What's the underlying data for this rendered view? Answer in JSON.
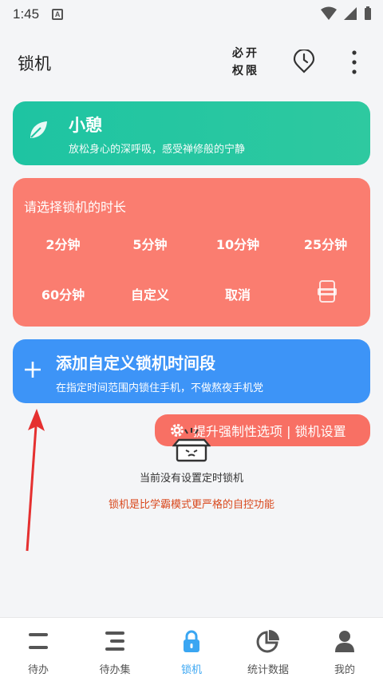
{
  "status": {
    "time": "1:45",
    "notif_letter": "A"
  },
  "appbar": {
    "title": "锁机",
    "perm_line1": "必开",
    "perm_line2": "权限",
    "clock_icon": "clock-icon",
    "more_icon": "more-vert-icon"
  },
  "rest_card": {
    "title": "小憩",
    "subtitle": "放松身心的深呼吸，感受禅修般的宁静",
    "icon": "leaf-icon",
    "color": "#1ec4a2"
  },
  "lock_card": {
    "heading": "请选择锁机的时长",
    "color": "#fa7d70",
    "options": [
      "2分钟",
      "5分钟",
      "10分钟",
      "25分钟",
      "60分钟",
      "自定义",
      "取消"
    ],
    "app_icon": "app-icon"
  },
  "add_card": {
    "title": "添加自定义锁机时间段",
    "subtitle": "在指定时间范围内锁住手机，不做熬夜手机党",
    "color": "#3d94f7"
  },
  "boost": {
    "label": "提升强制性选项 | 锁机设置",
    "icon": "gear-icon"
  },
  "empty": {
    "text": "当前没有设置定时锁机",
    "hint": "锁机是比学霸模式更严格的自控功能"
  },
  "tabs": [
    {
      "label": "待办",
      "icon": "todo-icon",
      "active": false
    },
    {
      "label": "待办集",
      "icon": "todo-list-icon",
      "active": false
    },
    {
      "label": "锁机",
      "icon": "lock-icon",
      "active": true
    },
    {
      "label": "统计数据",
      "icon": "pie-chart-icon",
      "active": false
    },
    {
      "label": "我的",
      "icon": "user-icon",
      "active": false
    }
  ],
  "colors": {
    "accent": "#3aa6f2",
    "hint": "#d9481c"
  }
}
